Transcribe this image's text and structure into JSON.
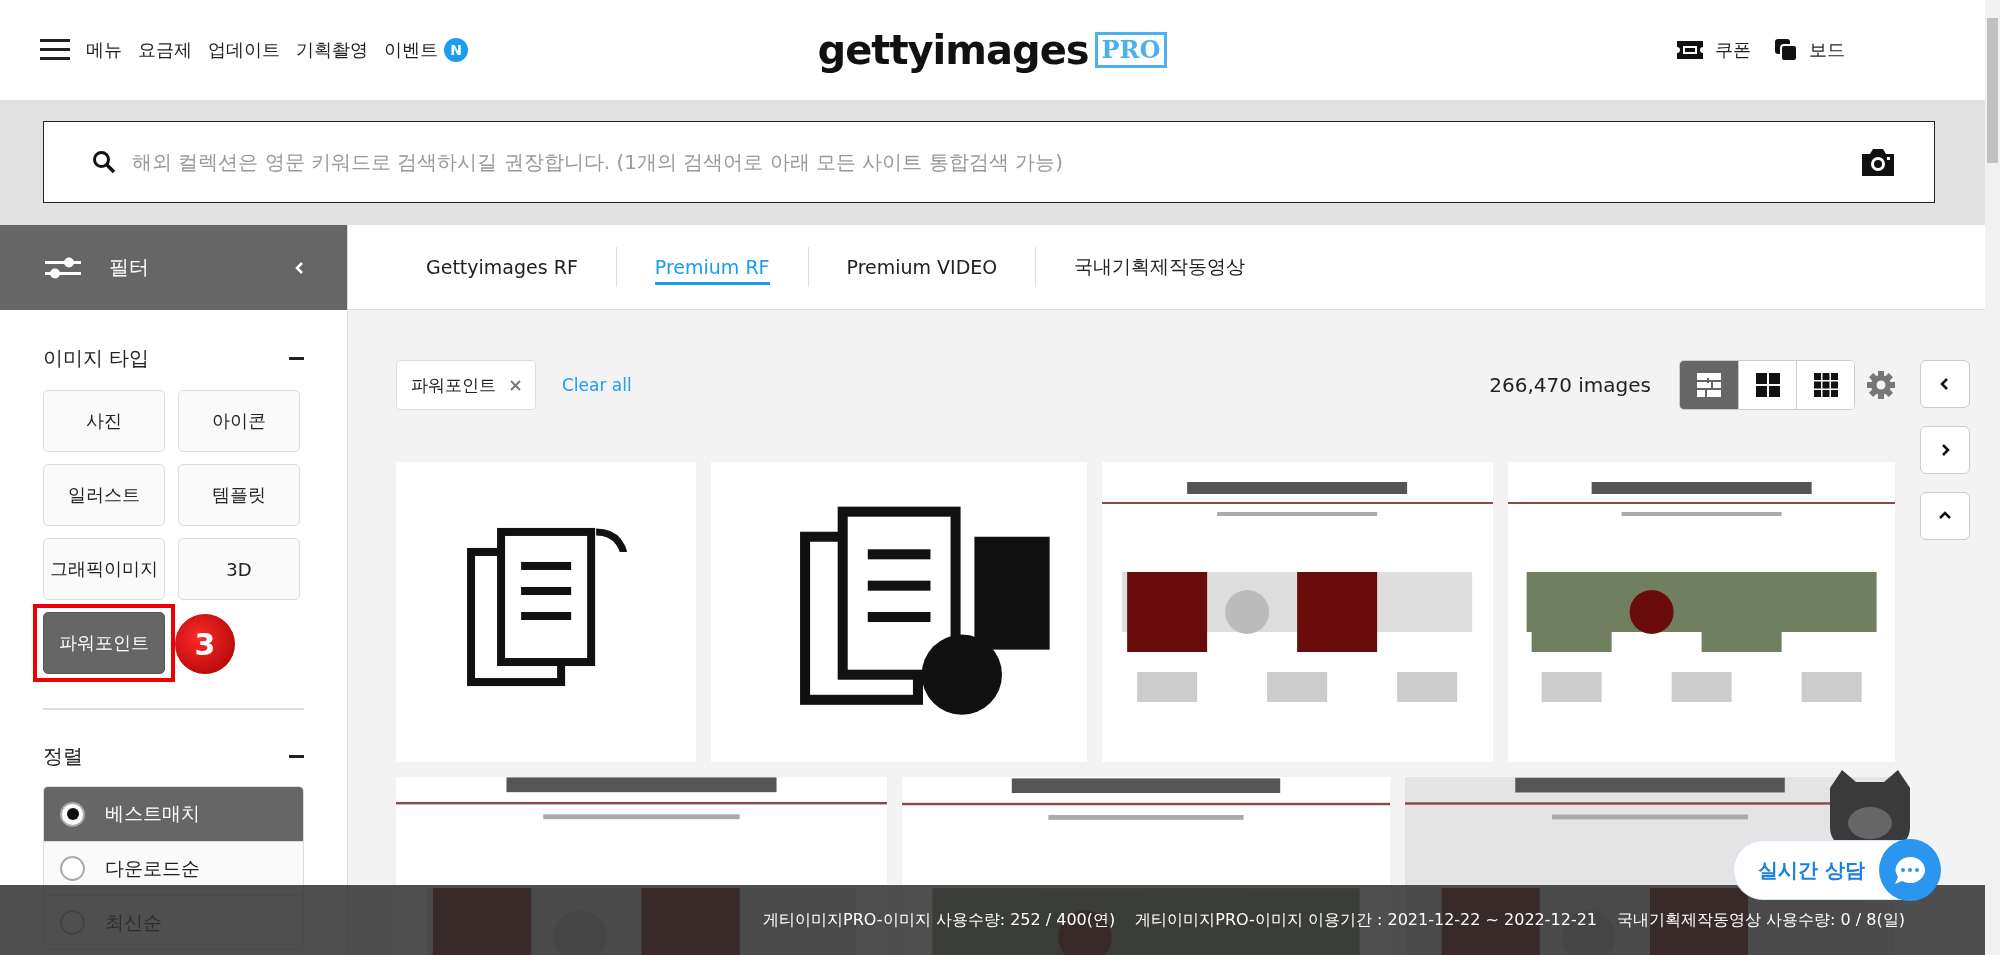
{
  "header": {
    "nav_items": [
      {
        "label": "메뉴"
      },
      {
        "label": "요금제"
      },
      {
        "label": "업데이트"
      },
      {
        "label": "기획촬영"
      },
      {
        "label": "이벤트",
        "badge": "N"
      }
    ],
    "logo": {
      "text": "gettyimages",
      "badge": "PRO"
    },
    "right_links": [
      {
        "kind": "coupon",
        "label": "쿠폰"
      },
      {
        "kind": "board",
        "label": "보드"
      }
    ]
  },
  "search": {
    "placeholder": "해외 컬렉션은 영문 키워드로 검색하시길 권장합니다. (1개의 검색어로 아래 모든 사이트 통합검색 가능)"
  },
  "filter": {
    "title": "필터"
  },
  "tabs": [
    {
      "label": "Gettyimages RF",
      "selected": false
    },
    {
      "label": "Premium RF",
      "selected": true
    },
    {
      "label": "Premium VIDEO",
      "selected": false
    },
    {
      "label": "국내기획제작동영상",
      "selected": false
    }
  ],
  "image_type": {
    "title": "이미지 타입",
    "options": [
      {
        "label": "사진",
        "selected": false
      },
      {
        "label": "아이콘",
        "selected": false
      },
      {
        "label": "일러스트",
        "selected": false
      },
      {
        "label": "템플릿",
        "selected": false
      },
      {
        "label": "그래픽이미지",
        "selected": false
      },
      {
        "label": "3D",
        "selected": false
      },
      {
        "label": "파워포인트",
        "selected": true,
        "annotation": "3"
      }
    ]
  },
  "sort": {
    "title": "정렬",
    "options": [
      {
        "label": "베스트매치",
        "selected": true
      },
      {
        "label": "다운로드순",
        "selected": false
      },
      {
        "label": "최신순",
        "selected": false
      }
    ]
  },
  "chips": [
    {
      "label": "파워포인트"
    }
  ],
  "clear_all": "Clear all",
  "result_count": "266,470 images",
  "view_modes": [
    {
      "kind": "masonry",
      "selected": true
    },
    {
      "kind": "large-grid",
      "selected": false
    },
    {
      "kind": "small-grid",
      "selected": false
    }
  ],
  "thumbnail_rows": [
    [
      {
        "kind": "icon"
      },
      {
        "kind": "icon"
      },
      {
        "kind": "slide"
      },
      {
        "kind": "slide"
      }
    ],
    [
      {
        "kind": "slide"
      },
      {
        "kind": "slide"
      },
      {
        "kind": "slide"
      }
    ]
  ],
  "chat": {
    "label": "실시간 상담"
  },
  "status_bar": {
    "items": [
      "게티이미지PRO-이미지 사용수량: 252 / 400(연)",
      "게티이미지PRO-이미지 이용기간 : 2021-12-22 ~ 2022-12-21",
      "국내기획제작동영상 사용수량: 0 / 8(일)"
    ]
  }
}
